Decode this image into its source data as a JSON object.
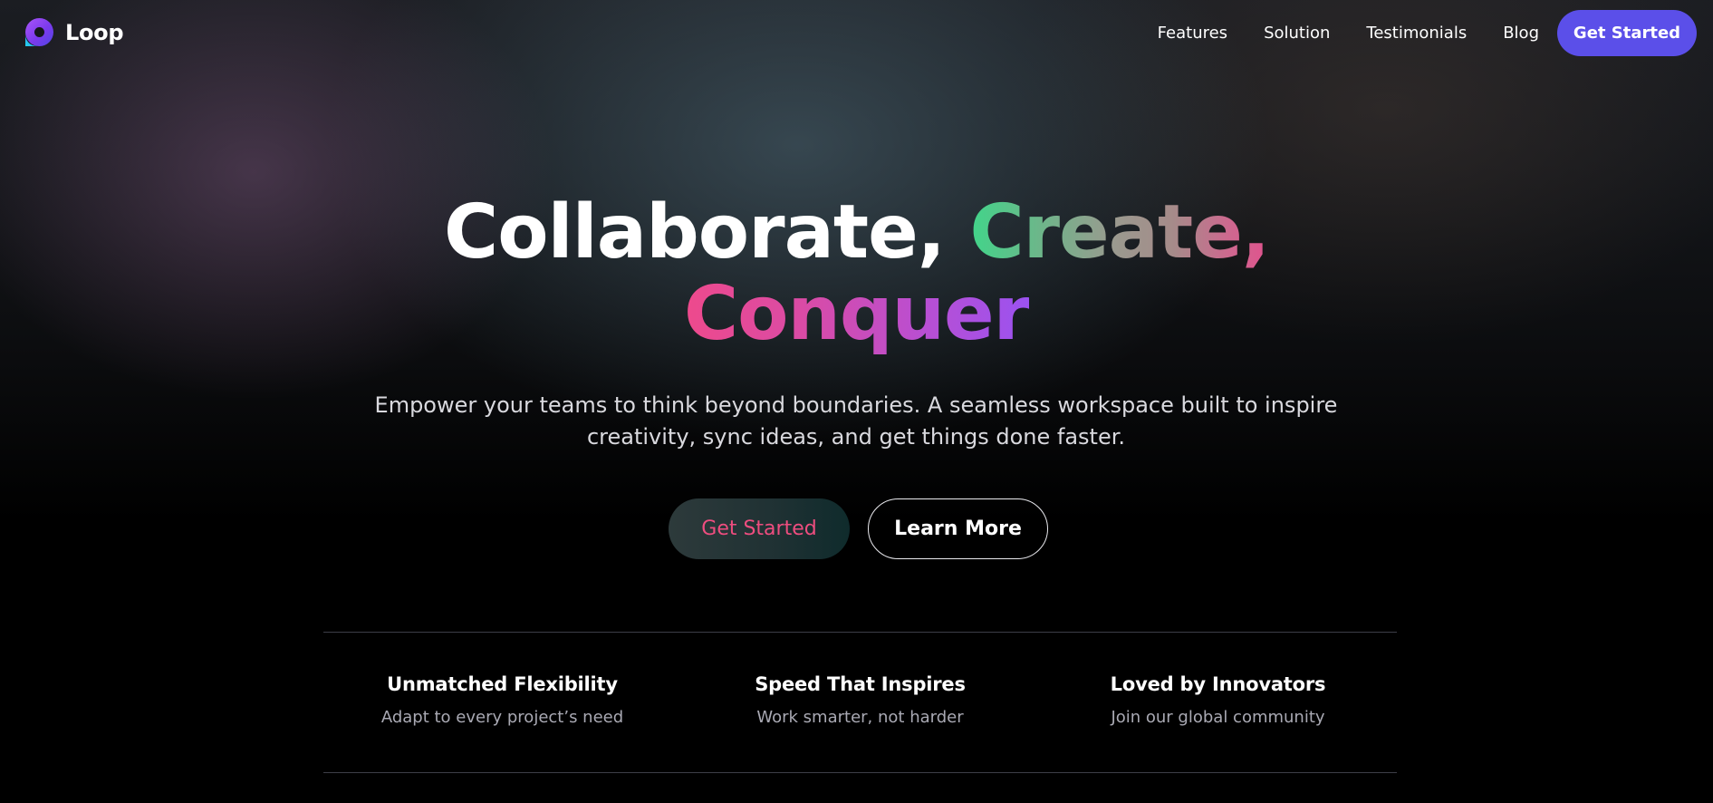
{
  "brand": {
    "name": "Loop",
    "accent": "#5b4fe9",
    "logo_icon": "loop-logo-icon"
  },
  "nav": {
    "links": [
      "Features",
      "Solution",
      "Testimonials",
      "Blog"
    ],
    "cta_label": "Get Started"
  },
  "hero": {
    "title_part1": "Collaborate,",
    "title_part2": "Create,",
    "title_part3": "Conquer",
    "subtitle": "Empower your teams to think beyond boundaries. A seamless workspace built to inspire creativity, sync ideas, and get things done faster.",
    "primary_button": "Get Started",
    "secondary_button": "Learn More"
  },
  "features": [
    {
      "title": "Unmatched Flexibility",
      "description": "Adapt to every project’s need"
    },
    {
      "title": "Speed That Inspires",
      "description": "Work smarter, not harder"
    },
    {
      "title": "Loved by Innovators",
      "description": "Join our global community"
    }
  ]
}
